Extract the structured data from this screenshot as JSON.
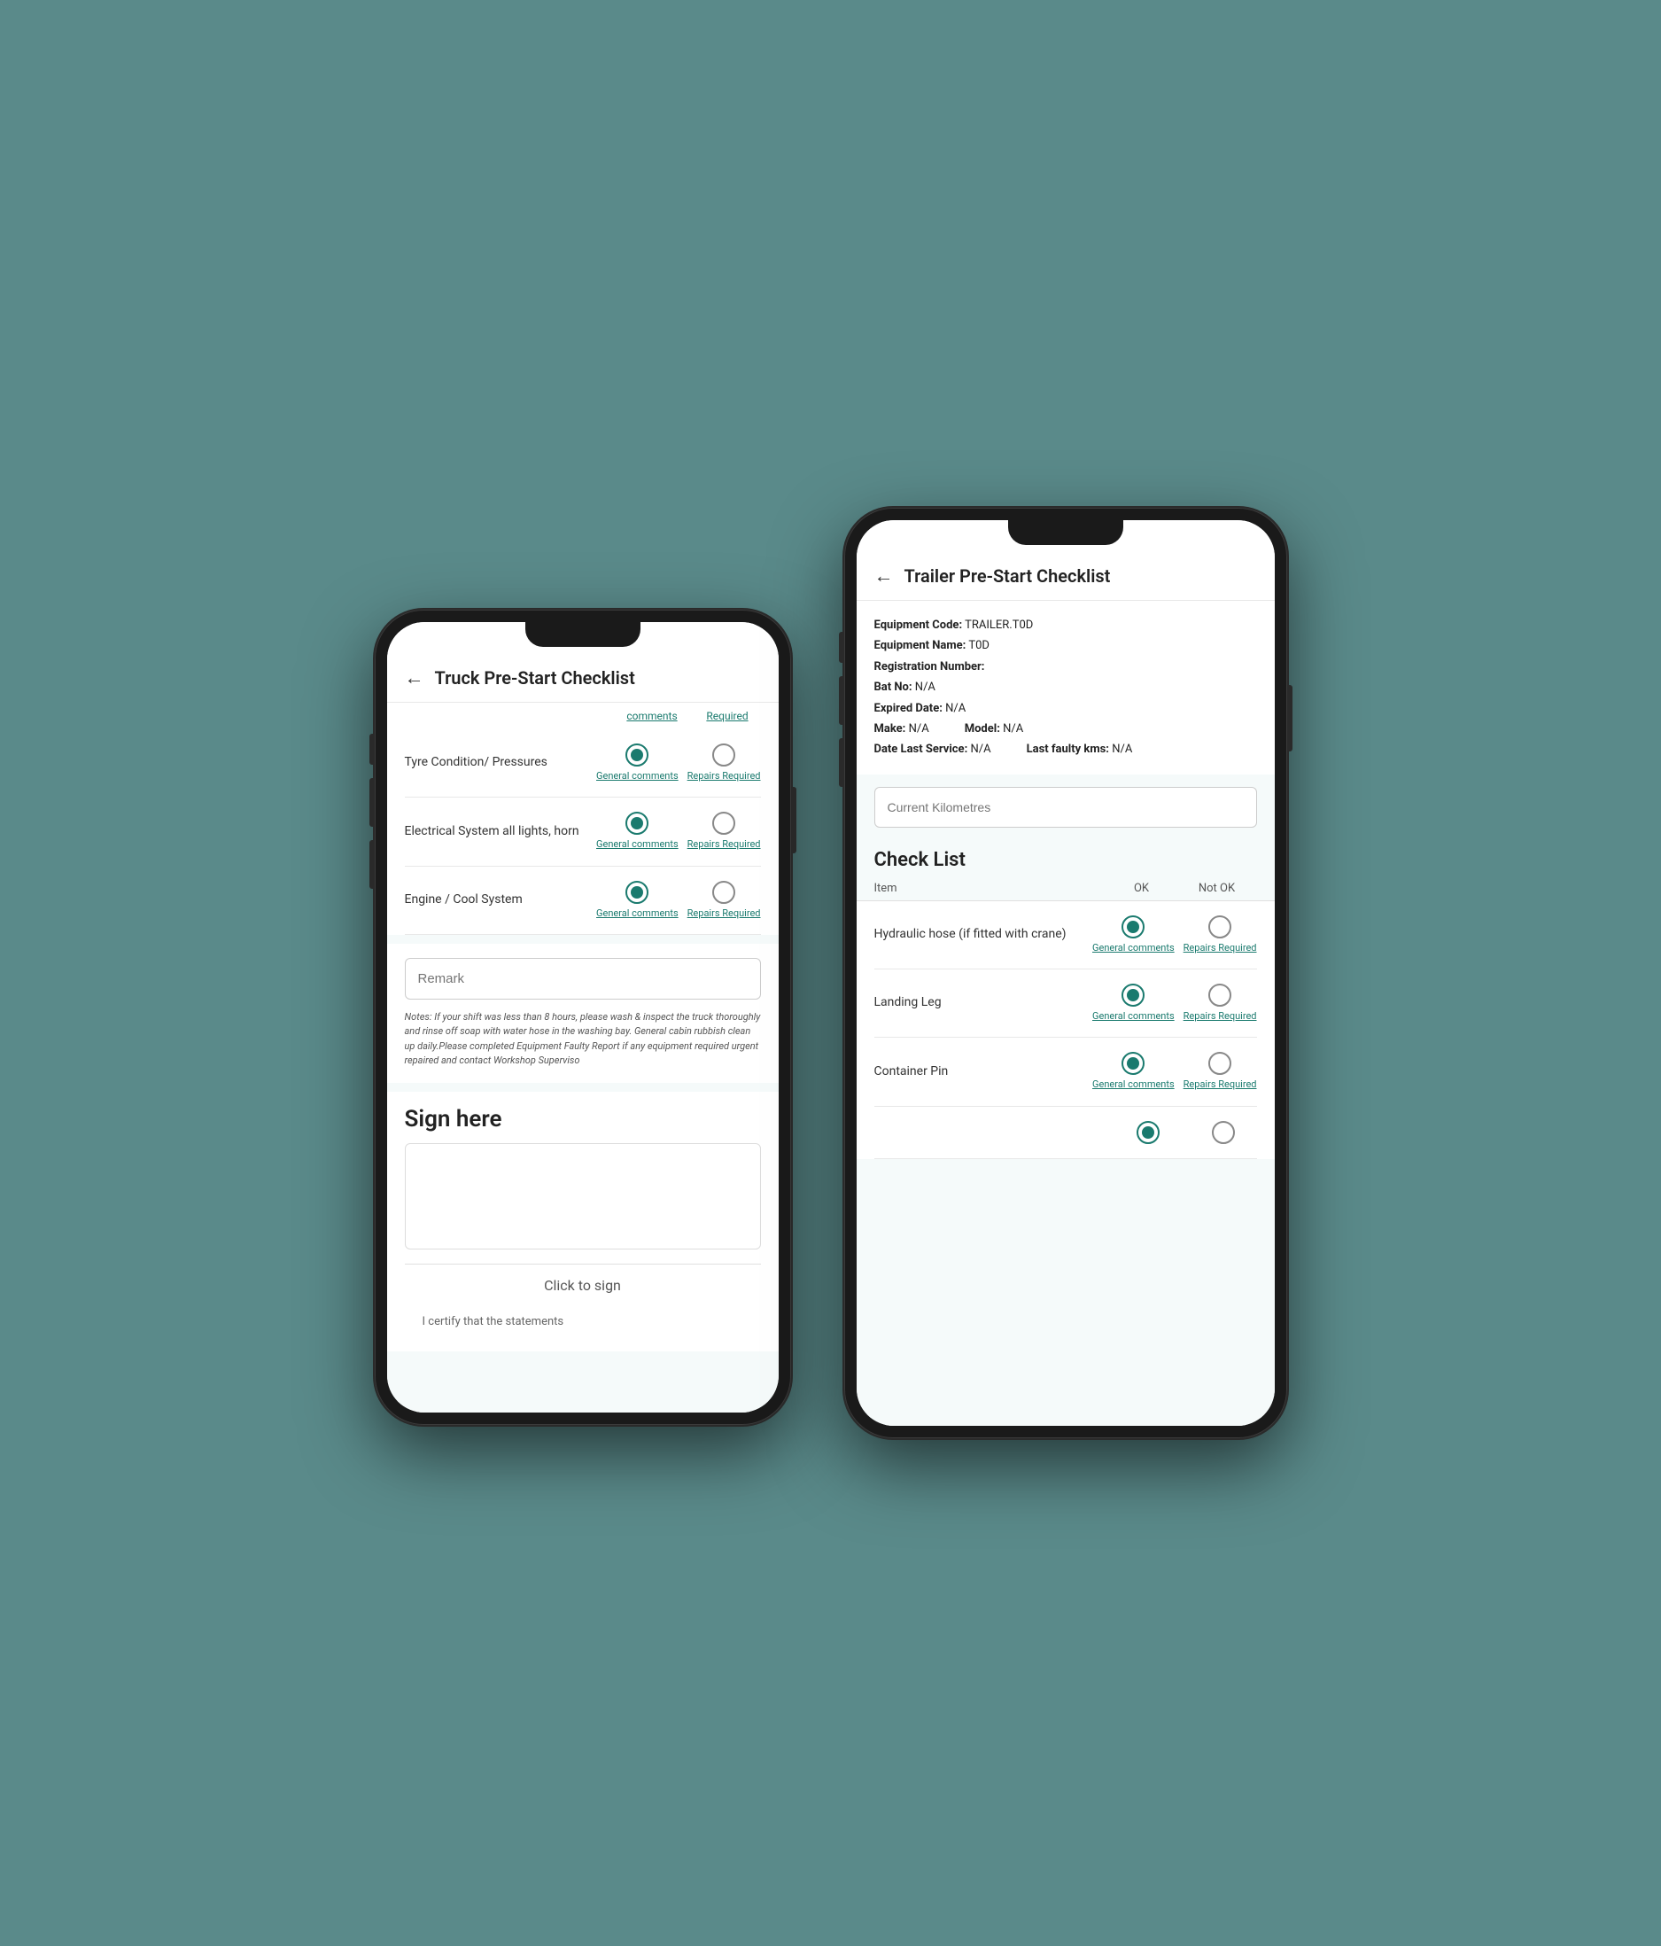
{
  "phone_left": {
    "header": {
      "back_label": "←",
      "title": "Truck Pre-Start Checklist"
    },
    "column_headers": {
      "col1": "comments",
      "col2": "Required"
    },
    "checklist_items": [
      {
        "label": "Tyre Condition/ Pressures",
        "ok_selected": true,
        "ok_link": "General comments",
        "notok_link": "Repairs Required"
      },
      {
        "label": "Electrical System all lights, horn",
        "ok_selected": true,
        "ok_link": "General comments",
        "notok_link": "Repairs Required"
      },
      {
        "label": "Engine / Cool System",
        "ok_selected": true,
        "ok_link": "General comments",
        "notok_link": "Repairs Required"
      }
    ],
    "remark": {
      "placeholder": "Remark"
    },
    "notes": "Notes: If your shift was less than 8 hours, please wash & inspect the truck thoroughly and rinse off soap with water hose in the washing bay. General cabin rubbish clean up daily.Please completed Equipment Faulty Report if any equipment required urgent repaired and contact Workshop Superviso",
    "sign_section": {
      "title": "Sign here",
      "click_to_sign": "Click to sign",
      "certify_text": "I certify that the statements"
    }
  },
  "phone_right": {
    "header": {
      "back_label": "←",
      "title": "Trailer Pre-Start Checklist"
    },
    "equipment": {
      "code_label": "Equipment Code:",
      "code_value": "TRAILER.T0D",
      "name_label": "Equipment Name:",
      "name_value": "T0D",
      "reg_label": "Registration Number:",
      "reg_value": "",
      "bat_label": "Bat No:",
      "bat_value": "N/A",
      "expired_label": "Expired Date:",
      "expired_value": "N/A",
      "make_label": "Make:",
      "make_value": "N/A",
      "model_label": "Model:",
      "model_value": "N/A",
      "service_label": "Date Last Service:",
      "service_value": "N/A",
      "faulty_label": "Last faulty kms:",
      "faulty_value": "N/A"
    },
    "km_placeholder": "Current Kilometres",
    "checklist_title": "Check List",
    "table_headers": {
      "item": "Item",
      "ok": "OK",
      "not_ok": "Not OK"
    },
    "checklist_items": [
      {
        "label": "Hydraulic hose (if fitted with crane)",
        "ok_selected": true,
        "ok_link": "General comments",
        "notok_link": "Repairs Required"
      },
      {
        "label": "Landing Leg",
        "ok_selected": true,
        "ok_link": "General comments",
        "notok_link": "Repairs Required"
      },
      {
        "label": "Container Pin",
        "ok_selected": true,
        "ok_link": "General comments",
        "notok_link": "Repairs Required"
      },
      {
        "label": "",
        "ok_selected": true,
        "ok_link": "",
        "notok_link": ""
      }
    ]
  }
}
